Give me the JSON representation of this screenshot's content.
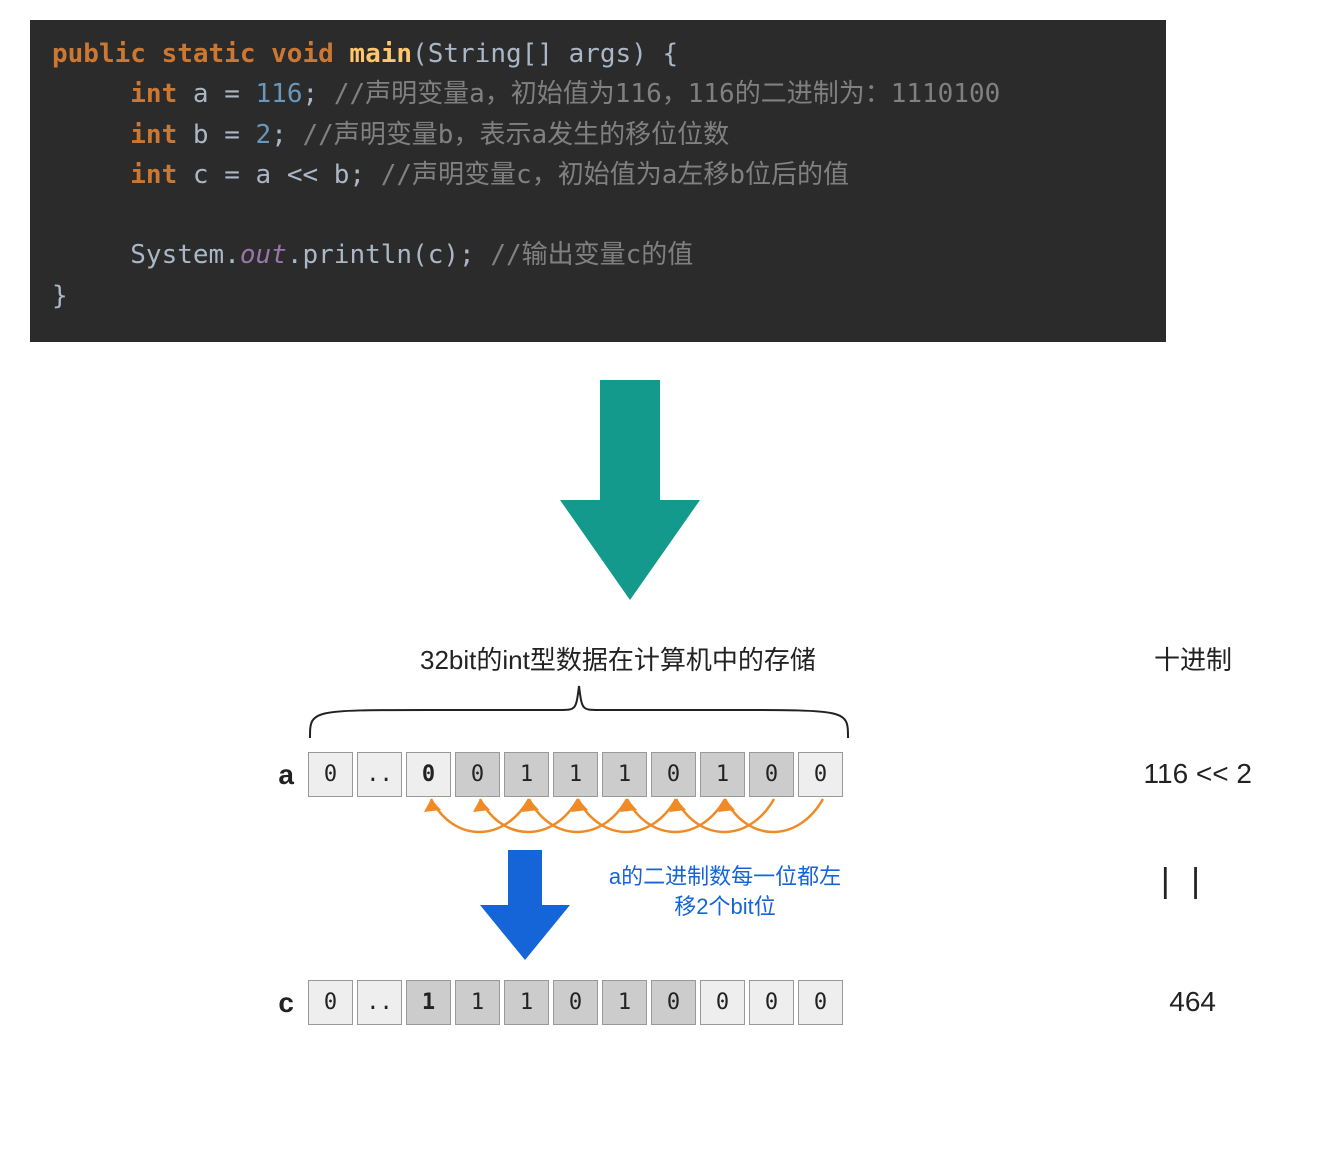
{
  "code": {
    "line1_kw": "public static void",
    "line1_fn": " main",
    "line1_rest": "(String[] args) {",
    "line2_kw": "int",
    "line2_rest": " a = ",
    "line2_num": "116",
    "line2_semi": "; ",
    "line2_cmt": "//声明变量a，初始值为116，116的二进制为：1110100",
    "line3_kw": "int",
    "line3_rest": " b = ",
    "line3_num": "2",
    "line3_semi": "; ",
    "line3_cmt": "//声明变量b，表示a发生的移位位数",
    "line4_kw": "int",
    "line4_rest": " c = a << b; ",
    "line4_cmt": "//声明变量c，初始值为a左移b位后的值",
    "line6a": "System.",
    "line6b": "out",
    "line6c": ".println(c); ",
    "line6_cmt": "//输出变量c的值",
    "line7": "}"
  },
  "diagram": {
    "header": "32bit的int型数据在计算机中的存储",
    "decimal_header": "十进制",
    "row_a_label": "a",
    "row_a_bits": [
      "0",
      "..",
      "0",
      "0",
      "1",
      "1",
      "1",
      "0",
      "1",
      "0",
      "0"
    ],
    "row_a_dark": [
      0,
      0,
      0,
      1,
      1,
      1,
      1,
      1,
      1,
      1,
      0
    ],
    "row_a_bold": [
      0,
      0,
      1,
      0,
      0,
      0,
      0,
      0,
      0,
      0,
      0
    ],
    "row_a_expr": "116 << 2",
    "shift_note": "a的二进制数每一位都左移2个bit位",
    "vbar": "| |",
    "row_c_label": "c",
    "row_c_bits": [
      "0",
      "..",
      "1",
      "1",
      "1",
      "0",
      "1",
      "0",
      "0",
      "0",
      "0"
    ],
    "row_c_dark": [
      0,
      0,
      1,
      1,
      1,
      1,
      1,
      1,
      0,
      0,
      0
    ],
    "row_c_bold": [
      0,
      0,
      1,
      0,
      0,
      0,
      0,
      0,
      0,
      0,
      0
    ],
    "row_c_expr": "464"
  },
  "colors": {
    "teal": "#149a8c",
    "blue": "#1565d8",
    "orange": "#f08a24"
  }
}
